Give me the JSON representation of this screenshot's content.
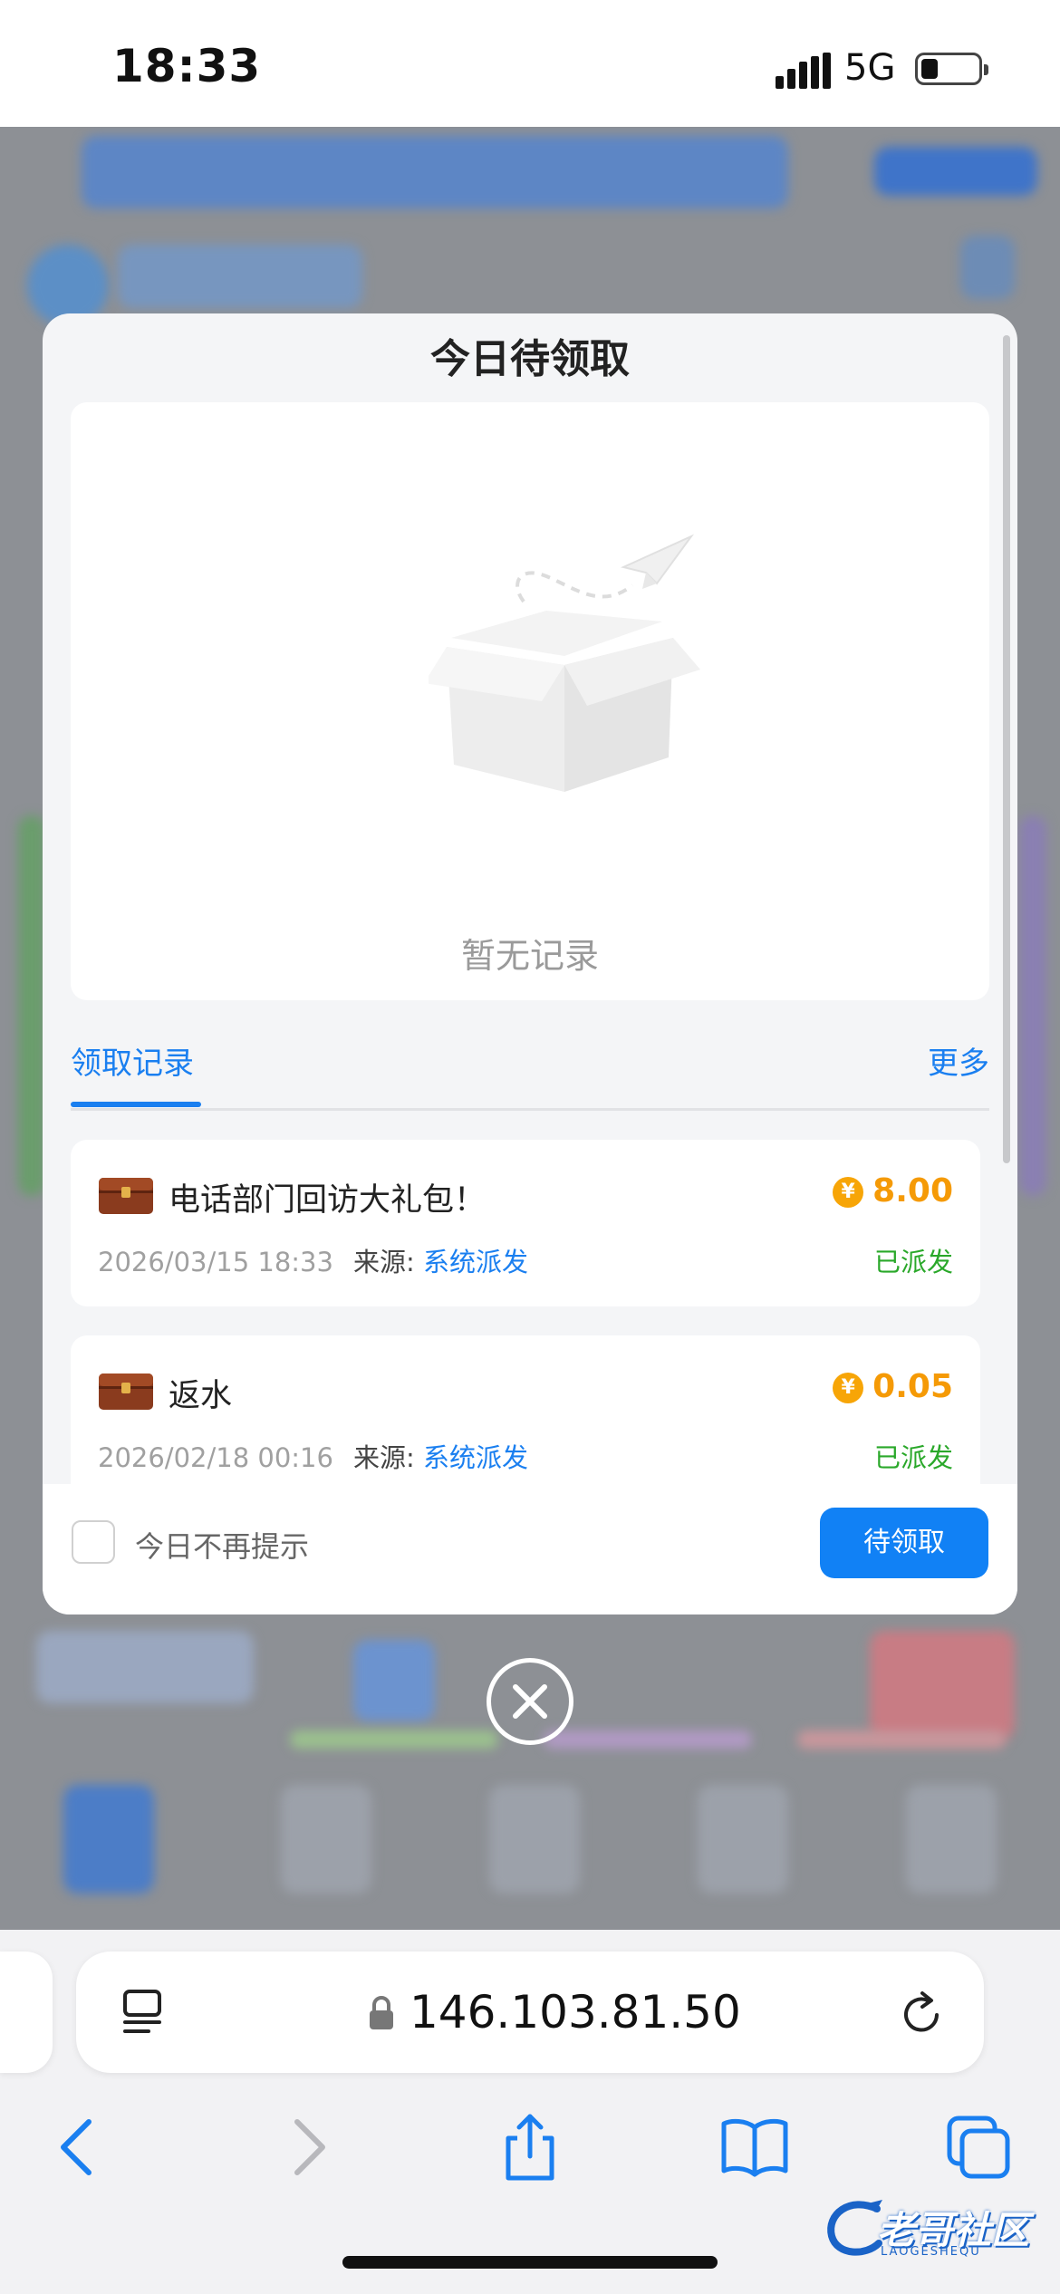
{
  "status_bar": {
    "time": "18:33",
    "network": "5G"
  },
  "modal": {
    "title": "今日待领取",
    "empty_text": "暂无记录",
    "tab_label": "领取记录",
    "more_label": "更多",
    "records": [
      {
        "title": "电话部门回访大礼包！",
        "amount": "8.00",
        "date": "2026/03/15 18:33",
        "source_label": "来源:",
        "source": "系统派发",
        "status": "已派发"
      },
      {
        "title": "返水",
        "amount": "0.05",
        "date": "2026/02/18 00:16",
        "source_label": "来源:",
        "source": "系统派发",
        "status": "已派发"
      }
    ],
    "checkbox_label": "今日不再提示",
    "claim_button": "待领取"
  },
  "browser": {
    "url": "146.103.81.50"
  },
  "watermark": {
    "text": "老哥社区",
    "sub": "LAOGESHEQU"
  },
  "colors": {
    "accent": "#1a7ff0",
    "amount": "#f59a06",
    "status_ok": "#2aa82a"
  }
}
